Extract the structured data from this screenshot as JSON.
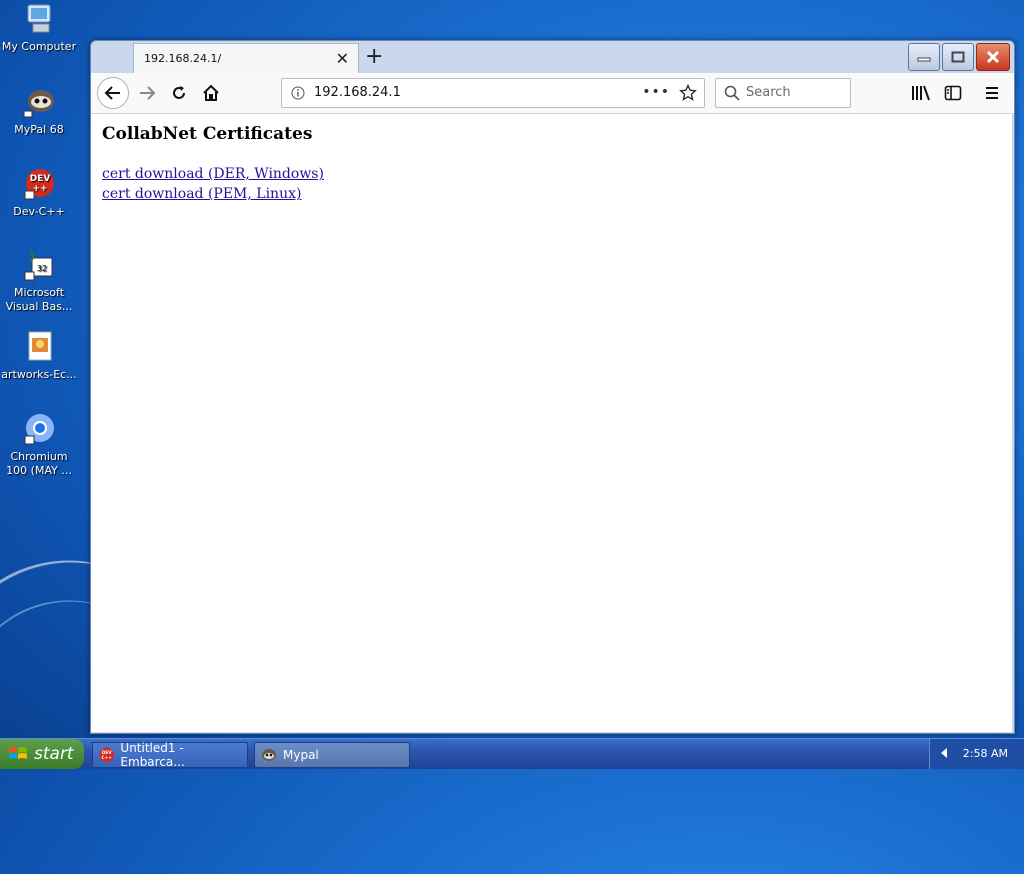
{
  "desktop": {
    "icons": [
      {
        "label": "My Computer",
        "icon": "computer-icon"
      },
      {
        "label": "MyPal 68",
        "icon": "mypal-icon"
      },
      {
        "label": "Dev-C++",
        "icon": "devcpp-icon"
      },
      {
        "label": "Microsoft Visual Bas...",
        "icon": "vb-icon"
      },
      {
        "label": "artworks-Ec...",
        "icon": "image-file-icon"
      },
      {
        "label": "Chromium 100 (MAY ...",
        "icon": "chromium-icon"
      }
    ]
  },
  "browser": {
    "tab_title": "192.168.24.1/",
    "url": "192.168.24.1",
    "search_placeholder": "Search",
    "page": {
      "heading": "CollabNet Certificates",
      "links": [
        "cert download (DER, Windows)",
        "cert download (PEM, Linux)"
      ]
    }
  },
  "taskbar": {
    "start_label": "start",
    "tasks": [
      {
        "label": "Untitled1 - Embarca...",
        "icon": "devcpp-icon"
      },
      {
        "label": "Mypal",
        "icon": "mypal-icon"
      }
    ],
    "clock": "2:58 AM"
  },
  "colors": {
    "link": "#221199",
    "desktop_blue": "#1a6fd0",
    "taskbar_blue": "#2a56ad",
    "start_green": "#3a7c2a"
  }
}
